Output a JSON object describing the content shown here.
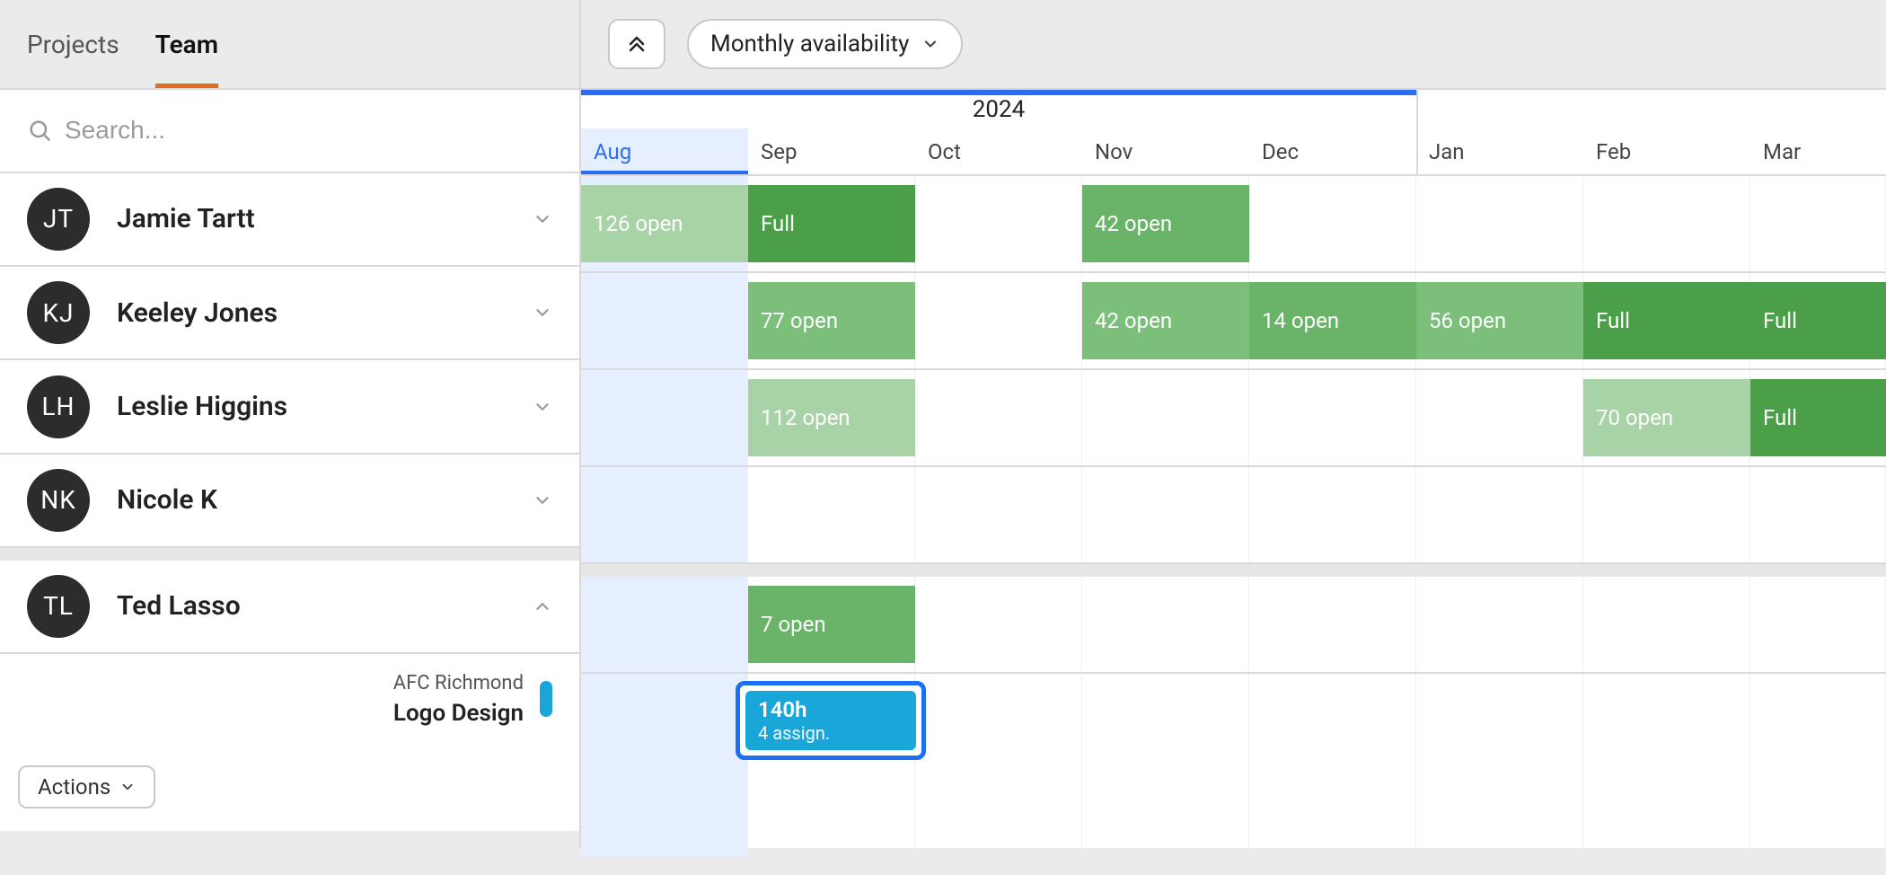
{
  "tabs": {
    "projects": "Projects",
    "team": "Team"
  },
  "controls": {
    "collapse_tooltip": "Collapse",
    "view_label": "Monthly availability"
  },
  "search": {
    "placeholder": "Search..."
  },
  "year": "2024",
  "months": [
    "Aug",
    "Sep",
    "Oct",
    "Nov",
    "Dec",
    "Jan",
    "Feb",
    "Mar"
  ],
  "people": [
    {
      "initials": "JT",
      "name": "Jamie Tartt",
      "expanded": false,
      "cells": [
        {
          "text": "126 open",
          "tone": "light"
        },
        {
          "text": "Full",
          "tone": "full"
        },
        null,
        {
          "text": "42 open",
          "tone": "med2"
        },
        null,
        null,
        null,
        null
      ]
    },
    {
      "initials": "KJ",
      "name": "Keeley Jones",
      "expanded": false,
      "cells": [
        null,
        {
          "text": "77 open",
          "tone": "med"
        },
        null,
        {
          "text": "42 open",
          "tone": "med"
        },
        {
          "text": "14 open",
          "tone": "med2"
        },
        {
          "text": "56 open",
          "tone": "med"
        },
        {
          "text": "Full",
          "tone": "full"
        },
        {
          "text": "Full",
          "tone": "full"
        }
      ]
    },
    {
      "initials": "LH",
      "name": "Leslie Higgins",
      "expanded": false,
      "cells": [
        null,
        {
          "text": "112 open",
          "tone": "light"
        },
        null,
        null,
        null,
        null,
        {
          "text": "70 open",
          "tone": "light"
        },
        {
          "text": "Full",
          "tone": "full"
        }
      ]
    },
    {
      "initials": "NK",
      "name": "Nicole K",
      "expanded": false,
      "cells": [
        null,
        null,
        null,
        null,
        null,
        null,
        null,
        null
      ]
    },
    {
      "initials": "TL",
      "name": "Ted Lasso",
      "expanded": true,
      "cells": [
        null,
        {
          "text": "7 open",
          "tone": "med2"
        },
        null,
        null,
        null,
        null,
        null,
        null
      ]
    }
  ],
  "task": {
    "client": "AFC Richmond",
    "name": "Logo Design",
    "assignment": {
      "hours": "140h",
      "sub": "4 assign."
    }
  },
  "actions_label": "Actions"
}
